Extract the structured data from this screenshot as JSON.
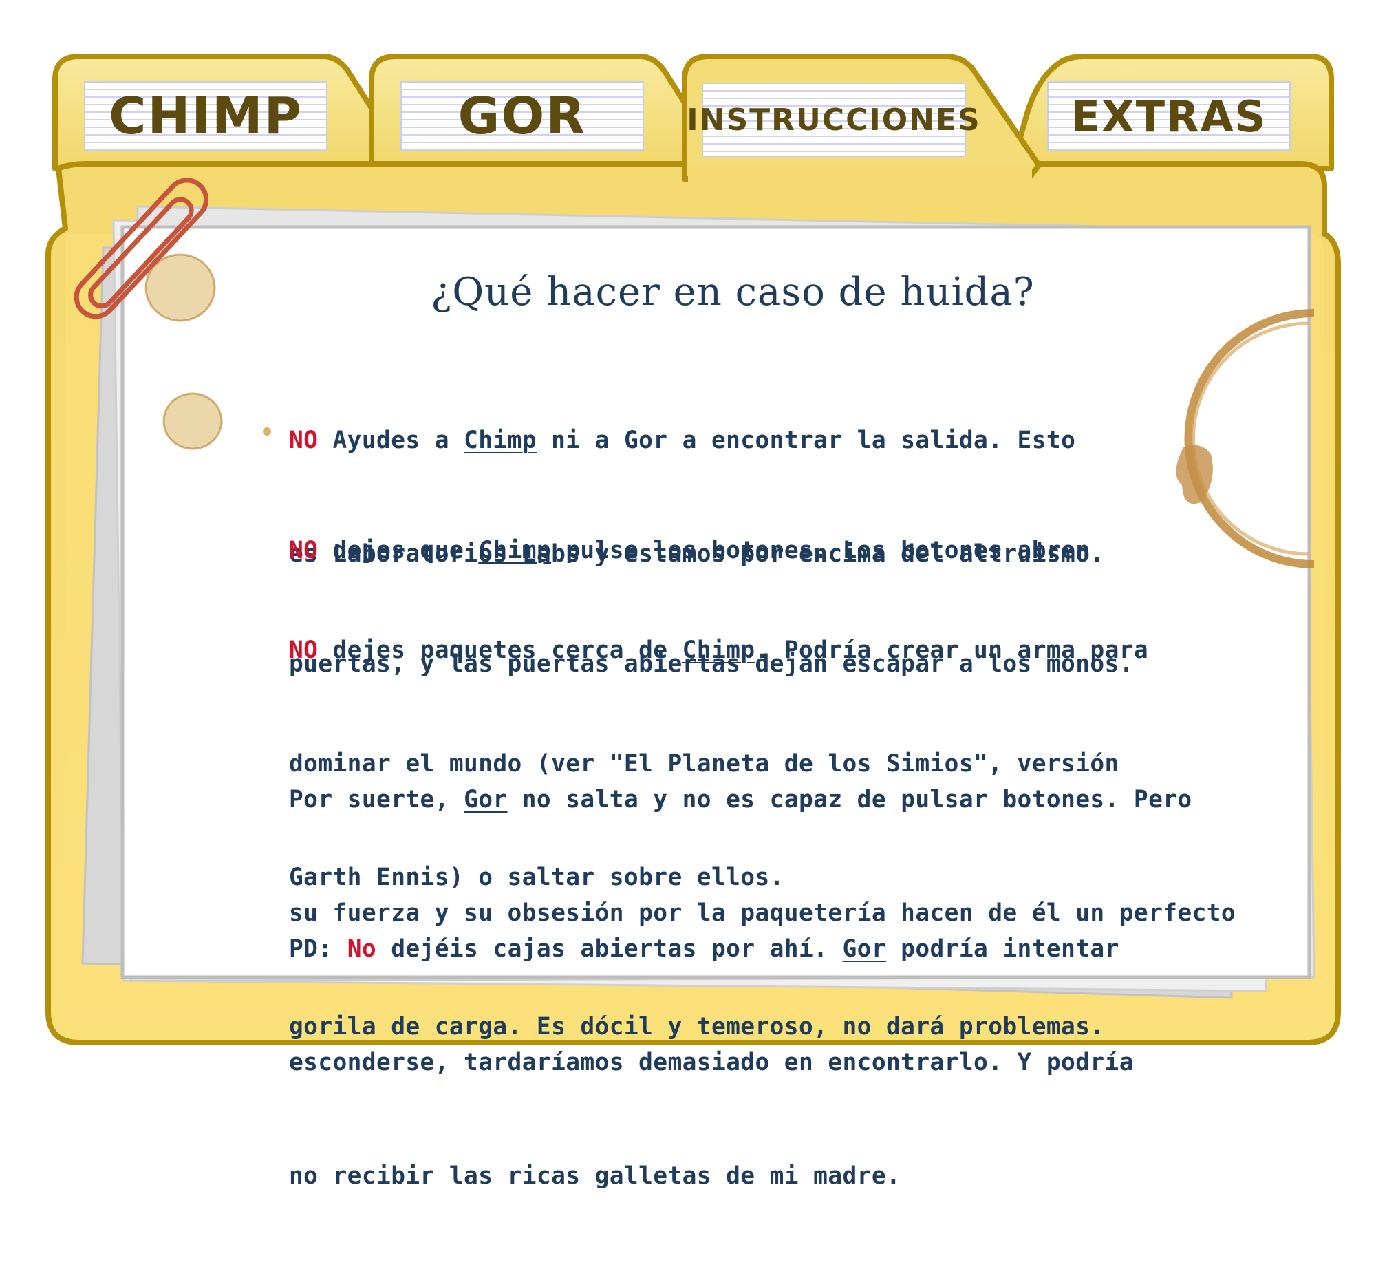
{
  "tabs": [
    {
      "label": "CHIMP"
    },
    {
      "label": "GOR"
    },
    {
      "label": "INSTRUCCIONES",
      "active": true
    },
    {
      "label": "EXTRAS"
    }
  ],
  "document": {
    "title": "¿Qué hacer en caso de huida?",
    "p1": {
      "neg": "NO",
      "a": " Ayudes a ",
      "name": "Chimp",
      "b": " ni a Gor a encontrar la salida. Esto",
      "line2": "es Laboratorios Labs y estamos por encima del altruismo."
    },
    "p2": {
      "neg": "NO",
      "a": " dejes que ",
      "name": "Chimp",
      "b": " pulse los botones. Los botones abren",
      "line2": "puertas, y las puertas abiertas dejan escapar a los monos."
    },
    "p3": {
      "neg": "NO",
      "a": " dejes paquetes cerca de ",
      "name": "Chimp",
      "b": ". Podría crear un arma para",
      "line2": "dominar el mundo (ver \"El Planeta de los Simios\", versión",
      "line3": "Garth Ennis) o saltar sobre ellos."
    },
    "p4": {
      "a": "Por suerte, ",
      "name": "Gor",
      "b": " no salta y no es capaz de pulsar botones. Pero",
      "line2": "su fuerza y su obsesión por la paquetería hacen de él un perfecto",
      "line3": "gorila de carga. Es dócil y temeroso, no dará problemas."
    },
    "p5": {
      "a": "PD: ",
      "neg": "No",
      "b": " dejéis cajas abiertas por ahí. ",
      "name": "Gor",
      "c": " podría intentar",
      "line2": "esconderse, tardaríamos demasiado en encontrarlo. Y podría",
      "line3": "no recibir las ricas galletas de mi madre."
    }
  },
  "colors": {
    "folder": "#f5dc74",
    "folder_outline": "#b38f0a",
    "tab_text": "#5c4a0f",
    "body_text": "#1f3c5c",
    "negation": "#d0142c",
    "paperclip": "#c8553b",
    "coffee_stain": "#b5832f"
  },
  "icons": [
    "paperclip-icon",
    "coffee-stain-icon",
    "coffee-ring-icon"
  ]
}
